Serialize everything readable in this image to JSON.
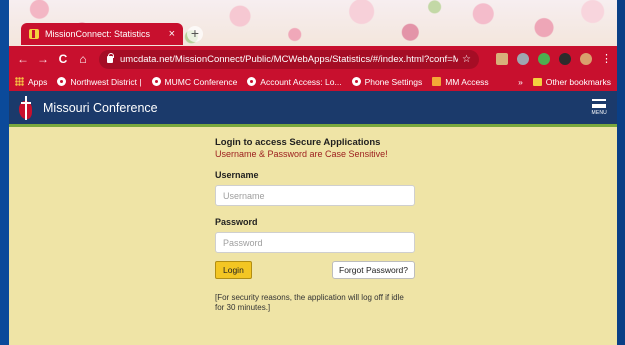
{
  "browser": {
    "tab_title": "MissionConnect: Statistics",
    "tab_close": "×",
    "new_tab": "+",
    "url": "umcdata.net/MissionConnect/Public/MCWebApps/Statistics/#/index.html?conf=MO",
    "bookmarks": [
      {
        "label": "Apps"
      },
      {
        "label": "Northwest District |"
      },
      {
        "label": "MUMC Conference"
      },
      {
        "label": "Account Access: Lo..."
      },
      {
        "label": "Phone Settings"
      },
      {
        "label": "MM Access"
      }
    ],
    "bookmarks_more": "»",
    "other_bookmarks": "Other bookmarks"
  },
  "site": {
    "name": "Missouri Conference",
    "menu_label": "MENU"
  },
  "login": {
    "heading": "Login to access Secure Applications",
    "subheading": "Username & Password are Case Sensitive!",
    "username_label": "Username",
    "username_placeholder": "Username",
    "password_label": "Password",
    "password_placeholder": "Password",
    "login_button": "Login",
    "forgot_button": "Forgot Password?",
    "notice": "[For security reasons, the application will log off if idle for 30 minutes.]"
  },
  "colors": {
    "accent": "#c8102e",
    "header": "#1b3a6b",
    "page_bg": "#efe4a6",
    "button": "#f3c623"
  }
}
